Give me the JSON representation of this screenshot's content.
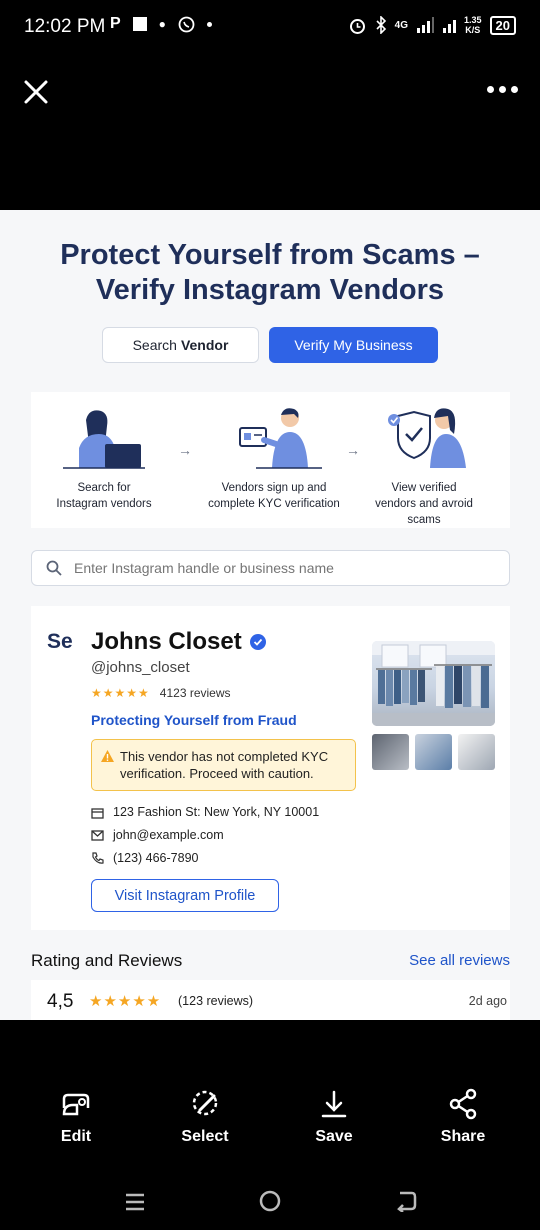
{
  "status_bar": {
    "time": "12:02 PM",
    "network": "4G",
    "speed_value": "1.35",
    "speed_unit": "K/S",
    "battery": "20"
  },
  "hero": {
    "title_line1": "Protect Yourself from Scams –",
    "title_line2": "Verify Instagram Vendors"
  },
  "buttons": {
    "search_prefix": "Search",
    "search_bold": "Vendor",
    "verify": "Verify My Business"
  },
  "steps": [
    {
      "label_line1": "Search for",
      "label_line2": "Instagram vendors",
      "label_line3": ""
    },
    {
      "label_line1": "Vendors sign up and",
      "label_line2": "complete KYC verification",
      "label_line3": ""
    },
    {
      "label_line1": "View verified",
      "label_line2": "vendors and avroid",
      "label_line3": "scams"
    }
  ],
  "search": {
    "placeholder": "Enter Instagram handle or business name"
  },
  "vendor": {
    "prefix": "Se",
    "name": "Johns Closet",
    "handle": "@johns_closet",
    "stars": "★★★★★",
    "reviews": "4123 reviews",
    "link": "Protecting Yourself from Fraud",
    "warning": "This vendor has not completed KYC verification. Proceed with caution.",
    "address": "123 Fashion St: New York, NY 10001",
    "email": "john@example.com",
    "phone": "(123) 466-7890",
    "visit_button": "Visit Instagram Profile"
  },
  "reviews": {
    "title": "Rating and Reviews",
    "see_all": "See all reviews",
    "score": "4,5",
    "stars": "★★★★★",
    "count": "(123 reviews)",
    "date": "2d ago"
  },
  "actions": {
    "edit": "Edit",
    "select": "Select",
    "save": "Save",
    "share": "Share"
  },
  "colors": {
    "accent": "#2f63e6",
    "title": "#1f2f5a",
    "star": "#f5a623",
    "warning_bg": "#fff5d9"
  }
}
